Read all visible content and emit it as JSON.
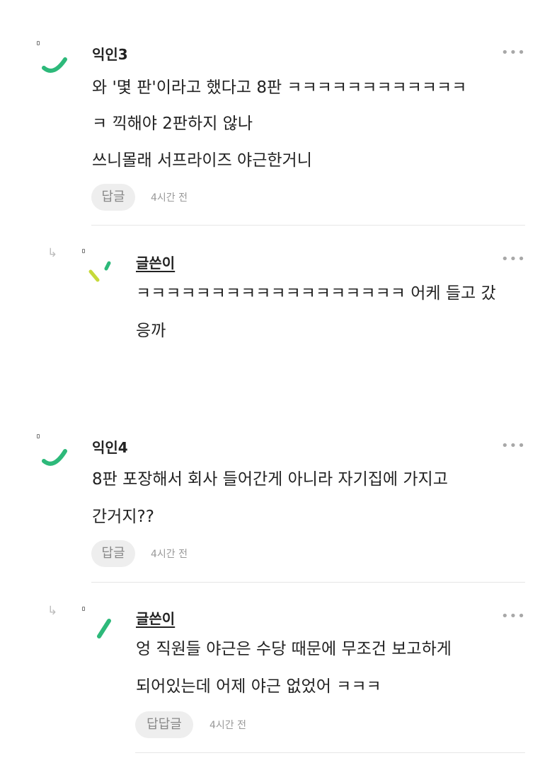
{
  "comments": [
    {
      "author": "익인3",
      "lines": [
        "와 '몇 판'이라고 했다고 8판 ㅋㅋㅋㅋㅋㅋㅋㅋㅋㅋㅋㅋ",
        "ㅋ 끽해야 2판하지 않나",
        "쓰니몰래 서프라이즈 야근한거니"
      ],
      "reply_button": "답글",
      "time": "4시간 전",
      "more_icon": "•••",
      "reply": {
        "author": "글쓴이",
        "lines": [
          "ㅋㅋㅋㅋㅋㅋㅋㅋㅋㅋㅋㅋㅋㅋㅋㅋㅋㅋ 어케 들고 갔",
          "응까"
        ]
      }
    },
    {
      "author": "익인4",
      "lines": [
        "8판 포장해서 회사 들어간게 아니라 자기집에 가지고",
        "간거지??"
      ],
      "reply_button": "답글",
      "time": "4시간 전",
      "more_icon": "•••",
      "reply": {
        "author": "글쓴이",
        "lines": [
          "엉 직원들 야근은 수당 때문에 무조건 보고하게",
          "되어있는데 어제 야근 없었어 ㅋㅋㅋ"
        ],
        "reply_button": "답답글",
        "time": "4시간 전"
      }
    }
  ],
  "reply_arrow_icon": "↳",
  "colors": {
    "avatar_green": "#2db97a",
    "avatar_lime": "#c6d93a",
    "reply_pill_bg": "#eeeeee"
  }
}
